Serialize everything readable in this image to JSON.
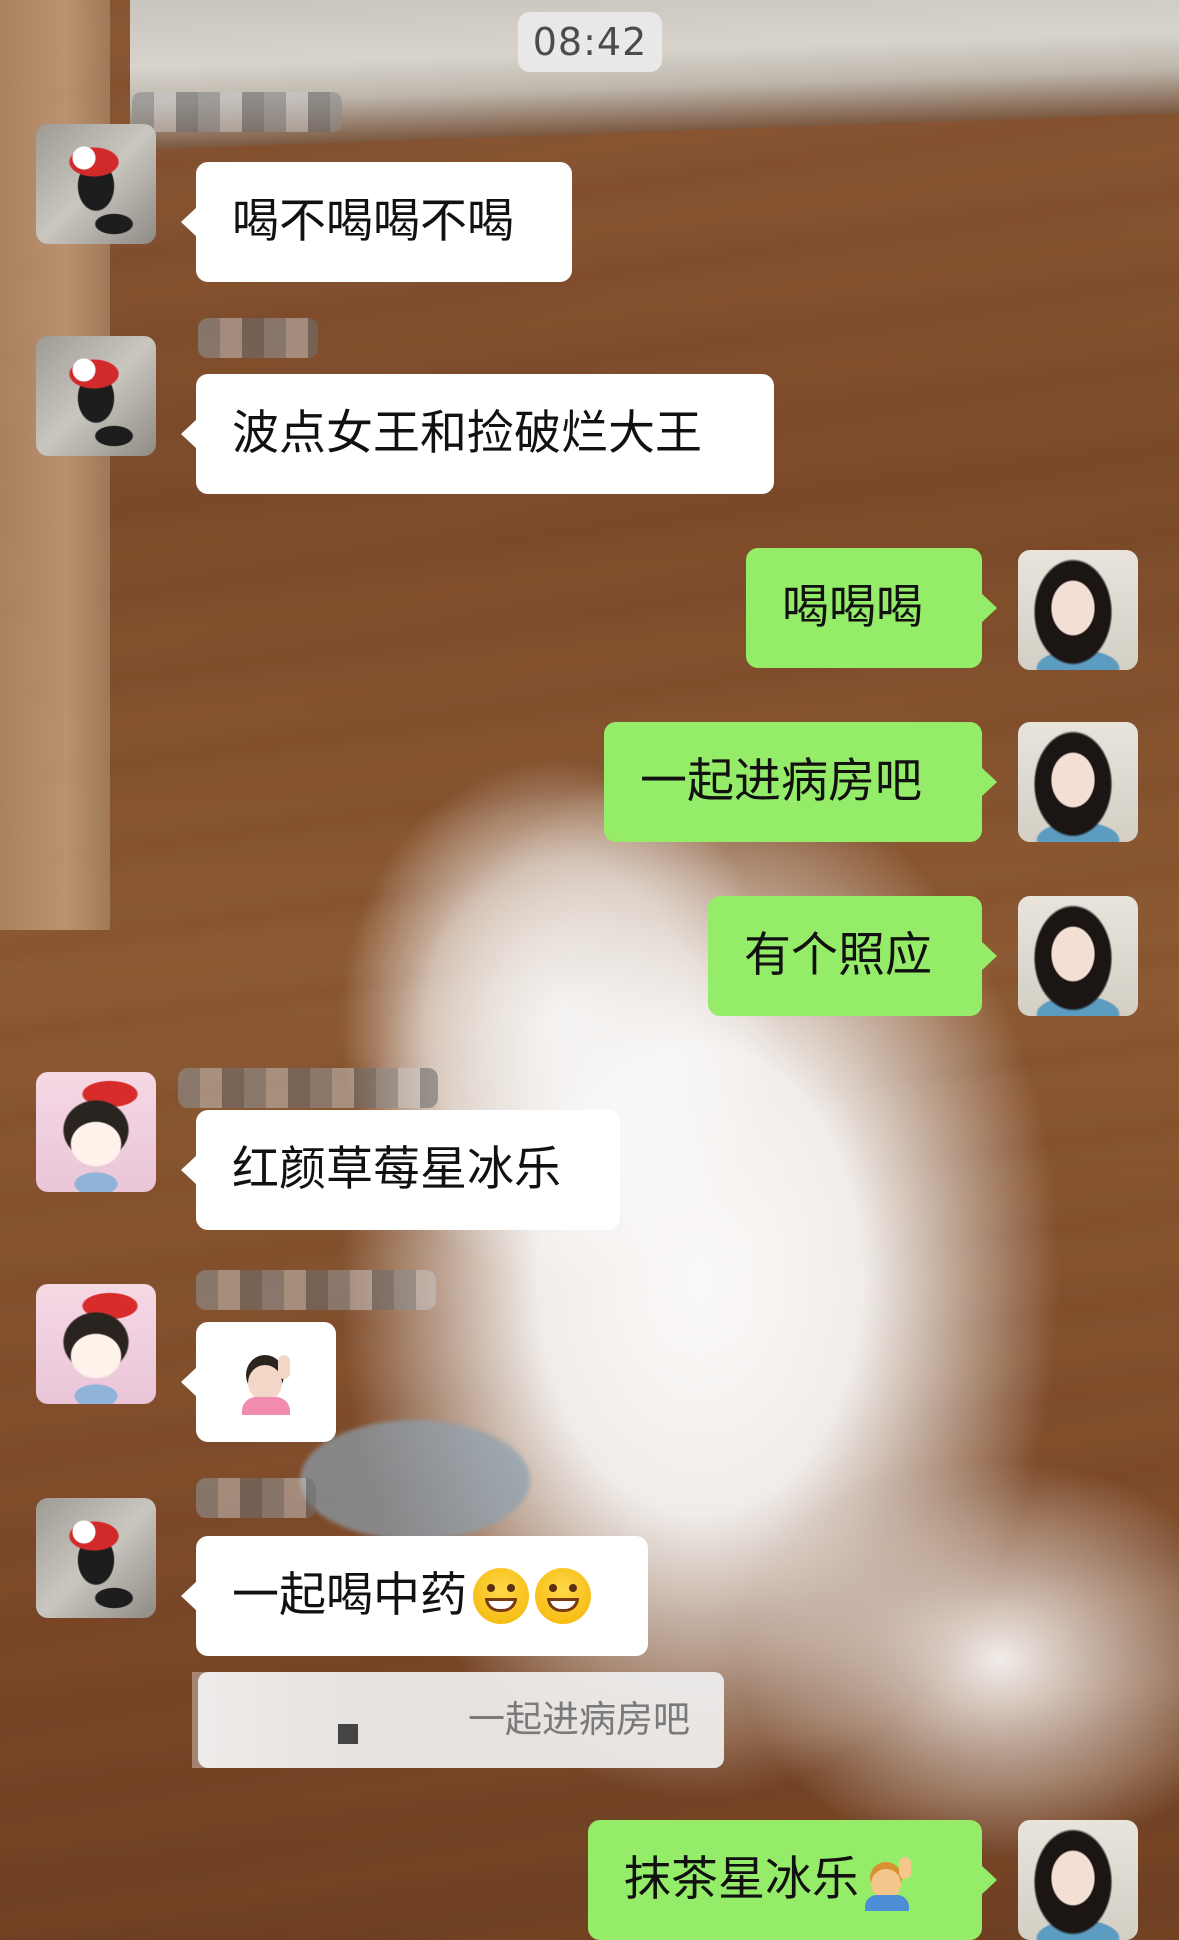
{
  "time": "08:42",
  "messages": [
    {
      "side": "in",
      "avatar": "cat-avatar",
      "text": "喝不喝喝不喝"
    },
    {
      "side": "in",
      "avatar": "cat-avatar",
      "text": "波点女王和捡破烂大王"
    },
    {
      "side": "out",
      "avatar": "girl-avatar",
      "text": "喝喝喝"
    },
    {
      "side": "out",
      "avatar": "girl-avatar",
      "text": "一起进病房吧"
    },
    {
      "side": "out",
      "avatar": "girl-avatar",
      "text": "有个照应"
    },
    {
      "side": "in",
      "avatar": "anime-avatar",
      "text": "红颜草莓星冰乐"
    },
    {
      "side": "in",
      "avatar": "anime-avatar",
      "emoji": "woman-raising-hand-emoji"
    },
    {
      "side": "in",
      "avatar": "cat-avatar",
      "text": "一起喝中药",
      "emojis": [
        "grinning-face-emoji",
        "grinning-face-emoji"
      ]
    },
    {
      "side": "out",
      "avatar": "girl-avatar",
      "text": "抹茶星冰乐",
      "emojis": [
        "man-raising-hand-emoji"
      ]
    }
  ],
  "quote": {
    "text": "一起进病房吧"
  }
}
